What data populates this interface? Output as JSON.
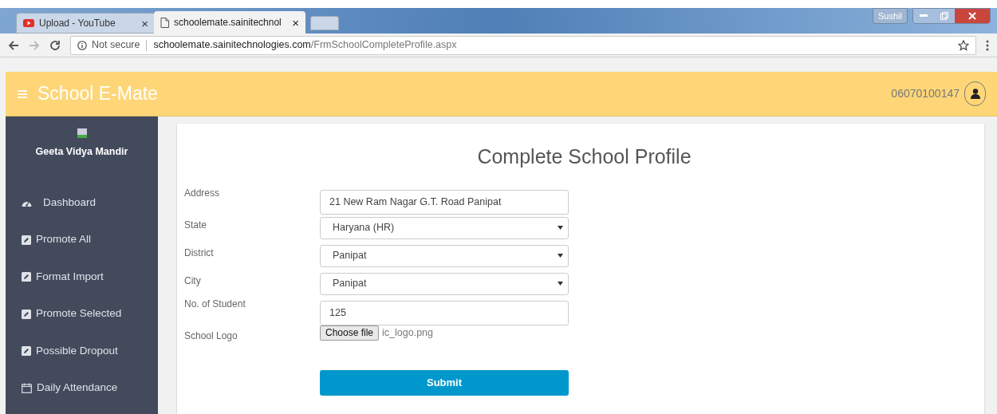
{
  "browser": {
    "tabs": [
      {
        "kind": "youtube",
        "title": "Upload - YouTube",
        "close": "×",
        "selected": false
      },
      {
        "kind": "page",
        "title": "schoolemate.sainitechnol",
        "close": "×",
        "selected": true
      }
    ],
    "profile": "Sushil",
    "address_bar": {
      "security": "Not secure",
      "host": "schoolemate.sainitechnologies.com",
      "path": "/FrmSchoolCompleteProfile.aspx"
    }
  },
  "header": {
    "menu_icon": "≡",
    "title": "School E-Mate",
    "user_id": "06070100147"
  },
  "sidebar": {
    "school_name": "Geeta Vidya Mandir",
    "items": [
      {
        "kind": "dashboard",
        "label": "Dashboard"
      },
      {
        "kind": "edit",
        "label": "Promote All"
      },
      {
        "kind": "edit",
        "label": "Format Import"
      },
      {
        "kind": "edit",
        "label": "Promote Selected"
      },
      {
        "kind": "edit",
        "label": "Possible Dropout"
      },
      {
        "kind": "calendar",
        "label": "Daily Attendance"
      }
    ]
  },
  "form": {
    "title": "Complete School Profile",
    "fields": [
      {
        "kind": "text",
        "label": "Address",
        "value": "21 New Ram Nagar G.T. Road Panipat"
      },
      {
        "kind": "select",
        "label": "State",
        "value": "Haryana (HR)"
      },
      {
        "kind": "select",
        "label": "District",
        "value": "Panipat"
      },
      {
        "kind": "select",
        "label": "City",
        "value": "Panipat"
      },
      {
        "kind": "text",
        "label": "No. of Student",
        "value": "125"
      },
      {
        "kind": "file",
        "label": "School Logo",
        "button": "Choose file",
        "value": "ic_logo.png"
      }
    ],
    "submit": "Submit"
  }
}
